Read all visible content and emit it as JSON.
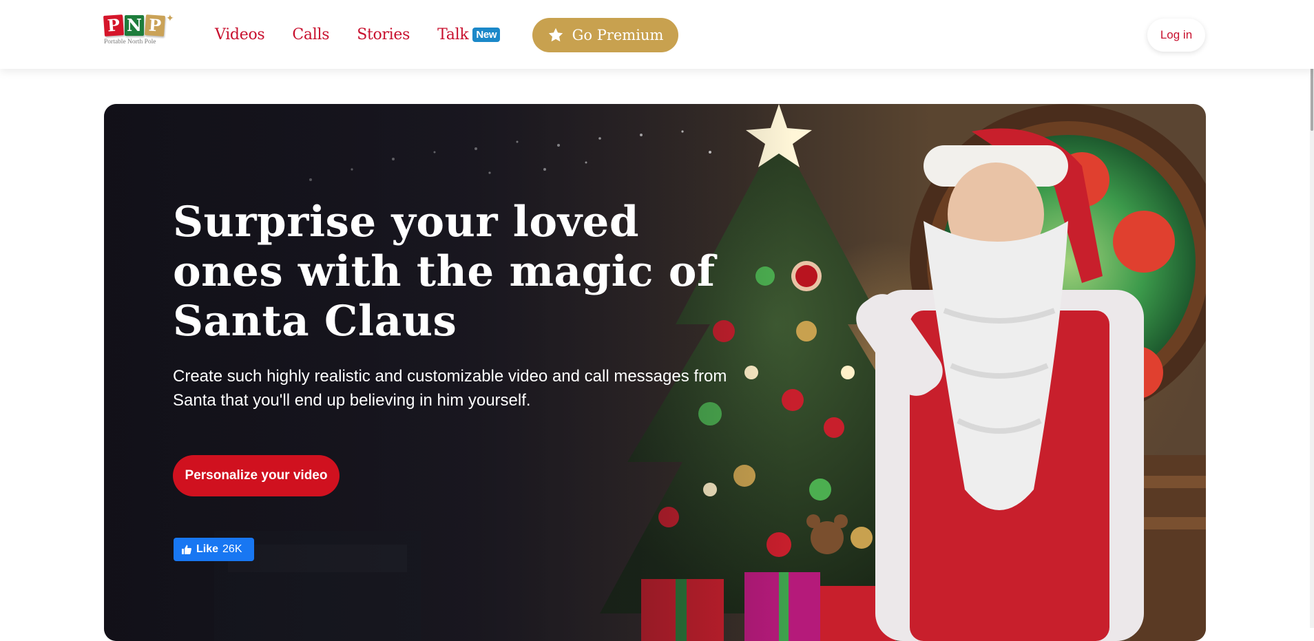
{
  "header": {
    "logo": {
      "letters": [
        "P",
        "N",
        "P"
      ],
      "subtitle": "Portable North Pole"
    },
    "nav": [
      {
        "label": "Videos"
      },
      {
        "label": "Calls"
      },
      {
        "label": "Stories"
      },
      {
        "label": "Talk",
        "badge": "New"
      }
    ],
    "premium_label": "Go Premium",
    "login_label": "Log in"
  },
  "hero": {
    "title": "Surprise your loved ones with the magic of Santa Claus",
    "subtitle": "Create such highly realistic and customizable video and call messages from Santa that you'll end up believing in him yourself.",
    "cta_label": "Personalize your video",
    "like": {
      "label": "Like",
      "count": "26K"
    }
  },
  "colors": {
    "brand_red": "#c8102e",
    "premium_gold": "#c8a14f",
    "cta_red": "#d0111f",
    "badge_blue": "#1b88c9",
    "facebook_blue": "#1877f2"
  },
  "icons": [
    "star-icon",
    "thumbs-up-icon"
  ]
}
